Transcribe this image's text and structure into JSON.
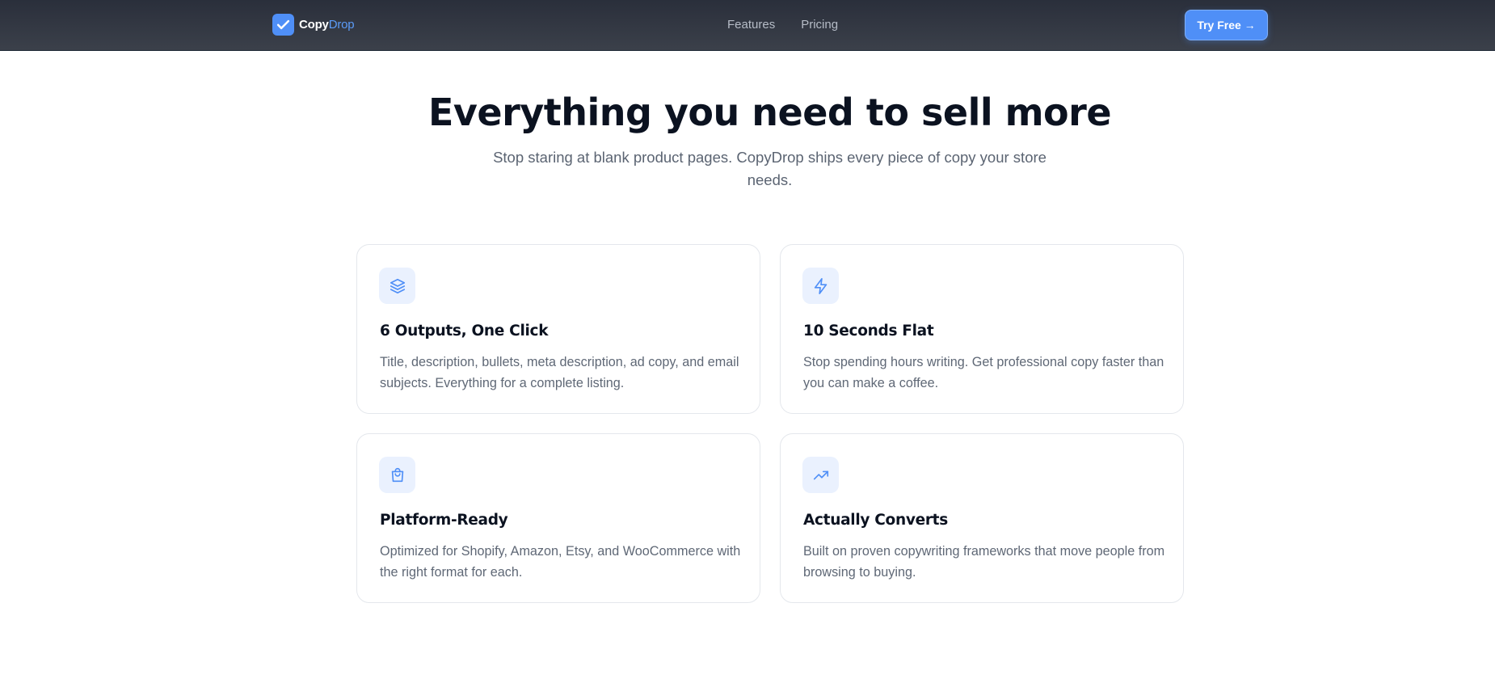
{
  "nav": {
    "brand_part1": "Copy",
    "brand_part2": "Drop",
    "links": [
      "Features",
      "Pricing"
    ],
    "cta_label": "Try Free →"
  },
  "hero": {
    "title": "Everything you need to sell more",
    "subtitle": "Stop staring at blank product pages. CopyDrop ships every piece of copy your store needs."
  },
  "features": [
    {
      "icon": "layers-icon",
      "title": "6 Outputs, One Click",
      "description": "Title, description, bullets, meta description, ad copy, and email subjects. Everything for a complete listing."
    },
    {
      "icon": "lightning-icon",
      "title": "10 Seconds Flat",
      "description": "Stop spending hours writing. Get professional copy faster than you can make a coffee."
    },
    {
      "icon": "shopping-bag-icon",
      "title": "Platform-Ready",
      "description": "Optimized for Shopify, Amazon, Etsy, and WooCommerce with the right format for each."
    },
    {
      "icon": "trending-up-icon",
      "title": "Actually Converts",
      "description": "Built on proven copywriting frameworks that move people from browsing to buying."
    }
  ],
  "colors": {
    "accent": "#4f8ff7",
    "navbar_bg": "#2f3440",
    "icon_tile_bg": "#eaf1fe"
  }
}
